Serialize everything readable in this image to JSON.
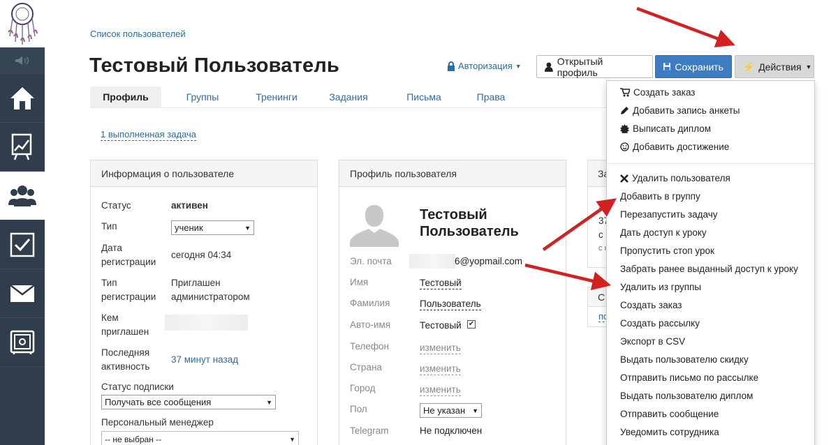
{
  "breadcrumb": "Список пользователей",
  "page_title": "Тестовый Пользователь",
  "header": {
    "auth_label": "Авторизация",
    "open_profile_label": "Открытый профиль",
    "save_label": "Сохранить",
    "actions_label": "Действия"
  },
  "tabs": [
    "Профиль",
    "Группы",
    "Тренинги",
    "Задания",
    "Письма",
    "Права"
  ],
  "task_link": "1 выполненная задача",
  "info_panel": {
    "title": "Информация о пользователе",
    "status_label": "Статус",
    "status_value": "активен",
    "type_label": "Тип",
    "type_value": "ученик",
    "reg_date_label_1": "Дата",
    "reg_date_label_2": "регистрации",
    "reg_date_value": "сегодня 04:34",
    "reg_type_label_1": "Тип",
    "reg_type_label_2": "регистрации",
    "reg_type_value_1": "Приглашен",
    "reg_type_value_2": "администратором",
    "invited_by_label_1": "Кем",
    "invited_by_label_2": "приглашен",
    "last_activity_label_1": "Последняя",
    "last_activity_label_2": "активность",
    "last_activity_value": "37 минут назад",
    "subscription_label": "Статус подписки",
    "subscription_value": "Получать все сообщения",
    "manager_label": "Персональный менеджер",
    "manager_value": "-- не выбран --"
  },
  "profile_panel": {
    "title": "Профиль пользователя",
    "name_line_1": "Тестовый",
    "name_line_2": "Пользователь",
    "email_label": "Эл. почта",
    "email_value": "6@yopmail.com",
    "first_name_label": "Имя",
    "first_name_value": "Тестовый",
    "last_name_label": "Фамилия",
    "last_name_value": "Пользователь",
    "auto_name_label": "Авто-имя",
    "auto_name_value": "Тестовый",
    "phone_label": "Телефон",
    "phone_value": "изменить",
    "country_label": "Страна",
    "country_value": "изменить",
    "city_label": "Город",
    "city_value": "изменить",
    "gender_label": "Пол",
    "gender_value": "Не указан",
    "telegram_label": "Telegram",
    "telegram_value": "Не подключен"
  },
  "third_panel": {
    "title": "За",
    "line1": "З",
    "line2": "37",
    "line3": "с",
    "line4": "с н"
  },
  "fourth_panel": {
    "title": "С",
    "line1": "по"
  },
  "actions_menu": {
    "top": [
      {
        "label": "Создать заказ",
        "icon": "cart-icon"
      },
      {
        "label": "Добавить запись анкеты",
        "icon": "pencil-icon"
      },
      {
        "label": "Выписать диплом",
        "icon": "certificate-icon"
      },
      {
        "label": "Добавить достижение",
        "icon": "smile-icon"
      }
    ],
    "bottom": [
      {
        "label": "Удалить пользователя",
        "icon": "close-icon"
      },
      {
        "label": "Добавить в группу"
      },
      {
        "label": "Перезапустить задачу"
      },
      {
        "label": "Дать доступ к уроку"
      },
      {
        "label": "Пропустить стоп урок"
      },
      {
        "label": "Забрать ранее выданный доступ к уроку"
      },
      {
        "label": "Удалить из группы"
      },
      {
        "label": "Создать заказ"
      },
      {
        "label": "Создать рассылку"
      },
      {
        "label": "Экспорт в CSV"
      },
      {
        "label": "Выдать пользователю скидку"
      },
      {
        "label": "Отправить письмо по рассылке"
      },
      {
        "label": "Выдать пользователю диплом"
      },
      {
        "label": "Отправить сообщение"
      },
      {
        "label": "Уведомить сотрудника"
      }
    ]
  },
  "colors": {
    "sidebar": "#2f3d4c",
    "link": "#2a6ea6",
    "save_button": "#3d7cc2",
    "arrow": "#d42020"
  }
}
